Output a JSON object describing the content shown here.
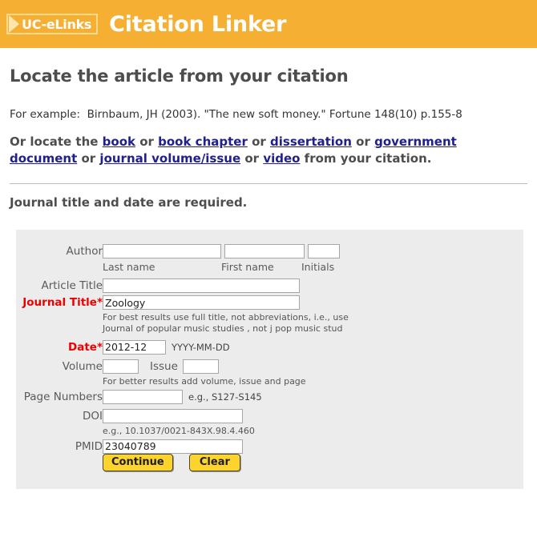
{
  "header": {
    "logo_text": "UC-eLinks",
    "logo_icon": "triangle-right-icon",
    "title": "Citation Linker",
    "bg_color": "#f5af32"
  },
  "intro": {
    "page_title": "Locate the article from your citation",
    "example_label": "For example:",
    "example_text": "Birnbaum, JH (2003). \"The new soft money.\" Fortune 148(10) p.155-8",
    "locate_prefix": "Or locate the ",
    "links": [
      {
        "label": "book"
      },
      {
        "label": "book chapter"
      },
      {
        "label": "dissertation"
      },
      {
        "label": "government document"
      },
      {
        "label": "journal volume/issue"
      },
      {
        "label": "video"
      }
    ],
    "sep_or": " or ",
    "locate_suffix": " from your citation.",
    "required_note": "Journal title and date are required."
  },
  "form": {
    "author": {
      "label": "Author",
      "last_name": {
        "value": "",
        "sublabel": "Last name"
      },
      "first_name": {
        "value": "",
        "sublabel": "First name"
      },
      "initials": {
        "value": "",
        "sublabel": "Initials"
      }
    },
    "article_title": {
      "label": "Article Title",
      "value": ""
    },
    "journal_title": {
      "label": "Journal Title",
      "required_marker": "*",
      "value": "Zoology",
      "hint_line1": "For best results use full title, not abbreviations, i.e., use",
      "hint_line2": "Journal of popular music studies , not j pop music stud"
    },
    "date": {
      "label": "Date",
      "required_marker": "*",
      "value": "2012-12",
      "hint": "YYYY-MM-DD"
    },
    "volume": {
      "label": "Volume",
      "value": ""
    },
    "issue": {
      "label": "Issue",
      "value": ""
    },
    "volume_issue_hint": "For better results add volume, issue and page",
    "page_numbers": {
      "label": "Page Numbers",
      "value": "",
      "hint": "e.g., S127-S145"
    },
    "doi": {
      "label": "DOI",
      "value": "",
      "hint": "e.g., 10.1037/0021-843X.98.4.460"
    },
    "pmid": {
      "label": "PMID",
      "value": "23040789"
    },
    "buttons": {
      "continue_label": "Continue",
      "clear_label": "Clear",
      "color": "#fdd32e"
    },
    "panel_bg": "#ececec",
    "required_color": "#ee0000"
  }
}
